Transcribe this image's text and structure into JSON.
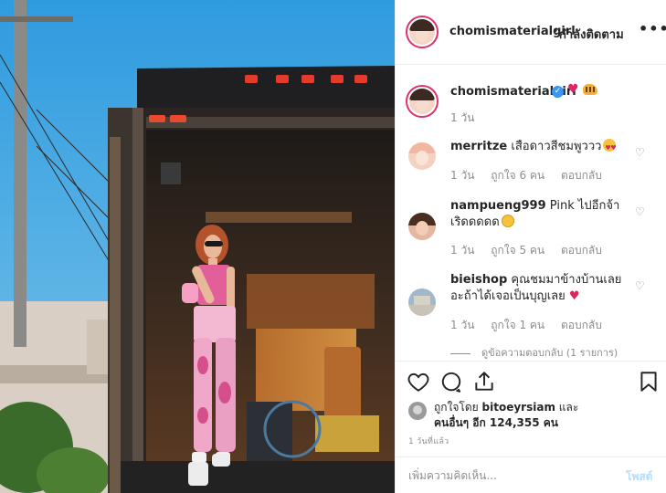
{
  "post": {
    "username": "chomismaterialgirl",
    "follow_separator": "•",
    "follow_label": "กำลังติดตาม",
    "more_label": "•••",
    "photo_alt": "woman-standing-in-open-truck"
  },
  "caption": {
    "username": "chomismaterialgirl",
    "verified_icon": "verified-badge-icon",
    "emojis": [
      "red-heart-emoji",
      "tiger-emoji"
    ],
    "time": "1 วัน"
  },
  "comments": [
    {
      "username": "merritze",
      "text": "เสือดาวสีชมพูววว",
      "emoji": "heart-eyes-emoji",
      "time": "1 วัน",
      "likes": "ถูกใจ 6 คน",
      "reply": "ตอบกลับ"
    },
    {
      "username": "nampueng999",
      "text": "Pink ไปอีกจ้า เริดดดดด",
      "emoji": "smiling-face-emoji",
      "time": "1 วัน",
      "likes": "ถูกใจ 5 คน",
      "reply": "ตอบกลับ"
    },
    {
      "username": "bieishop",
      "text": "คุณชมมาข้างบ้านเลยอะถ้าได้เจอเป็นบุญเลย",
      "emoji": "red-heart-emoji",
      "time": "1 วัน",
      "likes": "ถูกใจ 1 คน",
      "reply": "ตอบกลับ"
    }
  ],
  "view_replies": "ดูข้อความตอบกลับ (1 รายการ)",
  "actions": {
    "like_icon": "heart-icon",
    "comment_icon": "comment-icon",
    "share_icon": "share-icon",
    "save_icon": "bookmark-icon"
  },
  "likes": {
    "liked_by_prefix": "ถูกใจโดย",
    "liked_by_user": "bitoeyrsiam",
    "and_label": "และ",
    "others_label": "คนอื่นๆ อีก 124,355 คน"
  },
  "post_date": "1 วันที่แล้ว",
  "add_comment": {
    "placeholder": "เพิ่มความคิดเห็น...",
    "post_label": "โพสต์"
  },
  "colors": {
    "accent": "#3897f0",
    "post_button_disabled": "#b2dffc",
    "secondary_text": "#8e8e8e",
    "heart": "#e0245e"
  }
}
